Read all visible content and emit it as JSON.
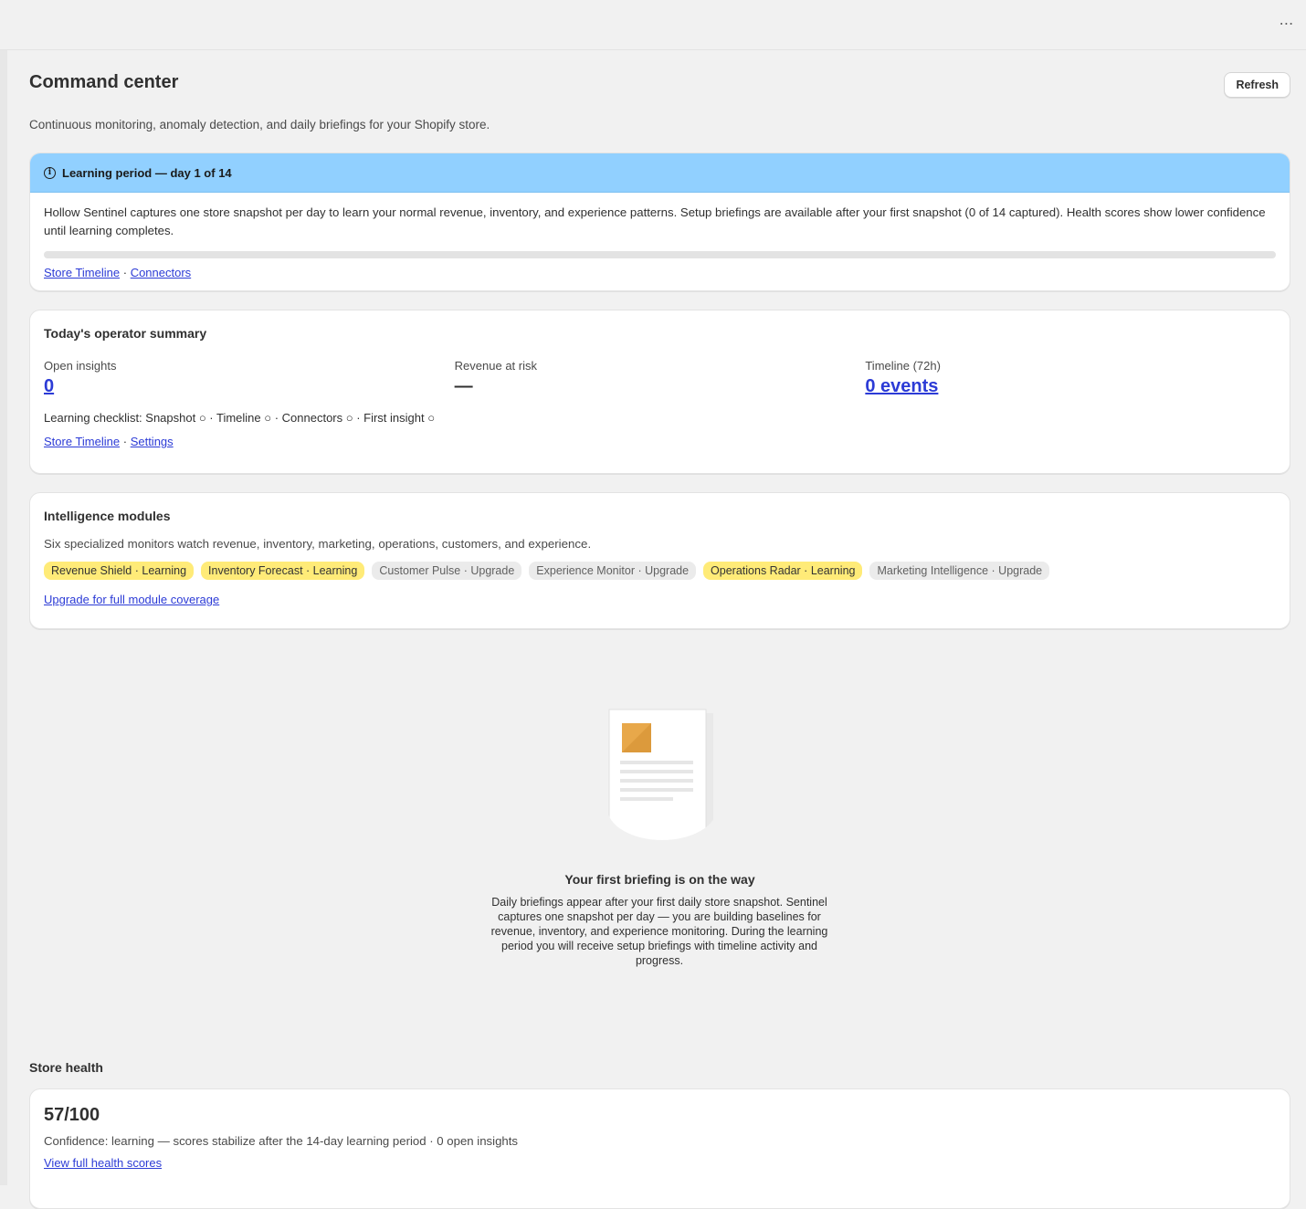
{
  "topbar": {
    "more_label": "⋯"
  },
  "page": {
    "title": "Command center",
    "refresh_label": "Refresh",
    "subtitle": "Continuous monitoring, anomaly detection, and daily briefings for your Shopify store."
  },
  "banner": {
    "title": "Learning period — day 1 of 14",
    "body": "Hollow Sentinel captures one store snapshot per day to learn your normal revenue, inventory, and experience patterns. Setup briefings are available after your first snapshot (0 of 14 captured). Health scores show lower confidence until learning completes.",
    "progress": 0,
    "link_timeline": "Store Timeline",
    "separator": "·",
    "link_connectors": "Connectors"
  },
  "summary": {
    "title": "Today's operator summary",
    "metrics": [
      {
        "label": "Open insights",
        "value": "0"
      },
      {
        "label": "Revenue at risk",
        "value": "—"
      },
      {
        "label": "Timeline (72h)",
        "value": "0 events"
      }
    ],
    "checklist": "Learning checklist: Snapshot ○ · Timeline ○ · Connectors ○ · First insight ○",
    "link_timeline": "Store Timeline",
    "separator": "·",
    "link_settings": "Settings"
  },
  "modules": {
    "title": "Intelligence modules",
    "description": "Six specialized monitors watch revenue, inventory, marketing, operations, customers, and experience.",
    "chips": [
      {
        "label": "Revenue Shield · Learning",
        "status": "learning"
      },
      {
        "label": "Inventory Forecast · Learning",
        "status": "learning"
      },
      {
        "label": "Customer Pulse · Upgrade",
        "status": "upgrade"
      },
      {
        "label": "Experience Monitor · Upgrade",
        "status": "upgrade"
      },
      {
        "label": "Operations Radar · Learning",
        "status": "learning"
      },
      {
        "label": "Marketing Intelligence · Upgrade",
        "status": "upgrade"
      }
    ],
    "upgrade_link": "Upgrade for full module coverage"
  },
  "empty_state": {
    "title": "Your first briefing is on the way",
    "text": "Daily briefings appear after your first daily store snapshot. Sentinel captures one snapshot per day — you are building baselines for revenue, inventory, and experience monitoring. During the learning period you will receive setup briefings with timeline activity and progress."
  },
  "health": {
    "section_title": "Store health",
    "score": "57/100",
    "confidence": "Confidence: learning — scores stabilize after the 14-day learning period · 0 open insights",
    "link": "View full health scores"
  },
  "colors": {
    "banner_bg": "#91d0ff",
    "chip_learning": "#ffeb78",
    "chip_upgrade": "#ebebeb",
    "link": "#2c3bd6",
    "illustration_accent": "#e8a84a"
  }
}
